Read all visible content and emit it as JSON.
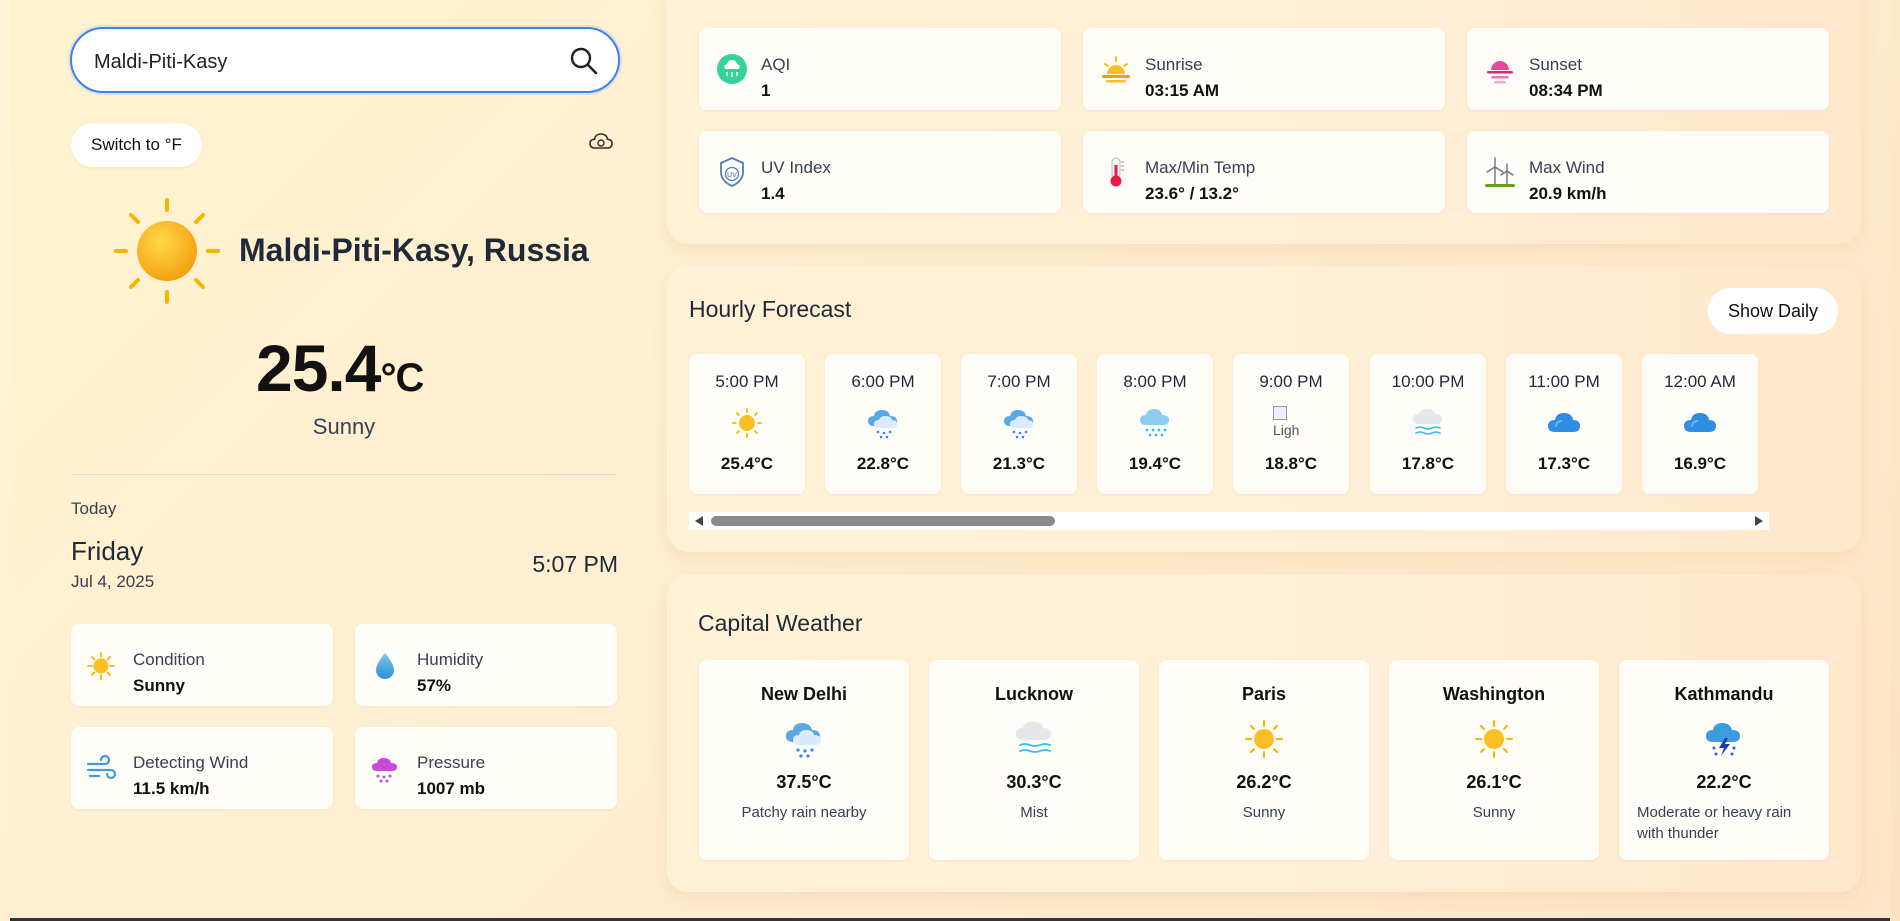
{
  "search": {
    "value": "Maldi-Piti-Kasy",
    "icon": "search-icon"
  },
  "unit_toggle_label": "Switch to °F",
  "current": {
    "location": "Maldi-Piti-Kasy, Russia",
    "temp": "25.4",
    "unit": "°C",
    "condition": "Sunny",
    "today_label": "Today",
    "day": "Friday",
    "date": "Jul 4, 2025",
    "time": "5:07 PM"
  },
  "stats": [
    {
      "label": "Condition",
      "value": "Sunny",
      "icon": "sun-icon"
    },
    {
      "label": "Humidity",
      "value": "57%",
      "icon": "droplet-icon"
    },
    {
      "label": "Detecting Wind",
      "value": "11.5 km/h",
      "icon": "wind-icon"
    },
    {
      "label": "Pressure",
      "value": "1007 mb",
      "icon": "pressure-cloud-icon"
    }
  ],
  "metrics": [
    {
      "label": "AQI",
      "value": "1",
      "icon": "aqi-icon"
    },
    {
      "label": "Sunrise",
      "value": "03:15 AM",
      "icon": "sunrise-icon"
    },
    {
      "label": "Sunset",
      "value": "08:34 PM",
      "icon": "sunset-icon"
    },
    {
      "label": "UV Index",
      "value": "1.4",
      "icon": "uv-shield-icon"
    },
    {
      "label": "Max/Min Temp",
      "value": "23.6° / 13.2°",
      "icon": "thermometer-icon"
    },
    {
      "label": "Max Wind",
      "value": "20.9 km/h",
      "icon": "wind-turbine-icon"
    }
  ],
  "hourly": {
    "title": "Hourly Forecast",
    "toggle_label": "Show Daily",
    "items": [
      {
        "time": "5:00 PM",
        "temp": "25.4°C",
        "icon": "sun-icon"
      },
      {
        "time": "6:00 PM",
        "temp": "22.8°C",
        "icon": "cloud-rain-icon"
      },
      {
        "time": "7:00 PM",
        "temp": "21.3°C",
        "icon": "cloud-rain-icon"
      },
      {
        "time": "8:00 PM",
        "temp": "19.4°C",
        "icon": "cloud-drizzle-icon"
      },
      {
        "time": "9:00 PM",
        "temp": "18.8°C",
        "icon": "broken-image-icon",
        "alt": "Ligh"
      },
      {
        "time": "10:00 PM",
        "temp": "17.8°C",
        "icon": "mist-icon"
      },
      {
        "time": "11:00 PM",
        "temp": "17.3°C",
        "icon": "cloud-icon"
      },
      {
        "time": "12:00 AM",
        "temp": "16.9°C",
        "icon": "cloud-icon"
      }
    ]
  },
  "capitals": {
    "title": "Capital Weather",
    "items": [
      {
        "name": "New Delhi",
        "temp": "37.5°C",
        "condition": "Patchy rain nearby",
        "icon": "cloud-rain-icon"
      },
      {
        "name": "Lucknow",
        "temp": "30.3°C",
        "condition": "Mist",
        "icon": "mist-icon"
      },
      {
        "name": "Paris",
        "temp": "26.2°C",
        "condition": "Sunny",
        "icon": "sun-icon"
      },
      {
        "name": "Washington",
        "temp": "26.1°C",
        "condition": "Sunny",
        "icon": "sun-icon"
      },
      {
        "name": "Kathmandu",
        "temp": "22.2°C",
        "condition": "Moderate or heavy rain with thunder",
        "icon": "thunder-rain-icon"
      }
    ]
  },
  "colors": {
    "accent": "#3b82f6",
    "sun": "#f5b400",
    "card": "#fffdf8",
    "background": "#fff3cf"
  }
}
